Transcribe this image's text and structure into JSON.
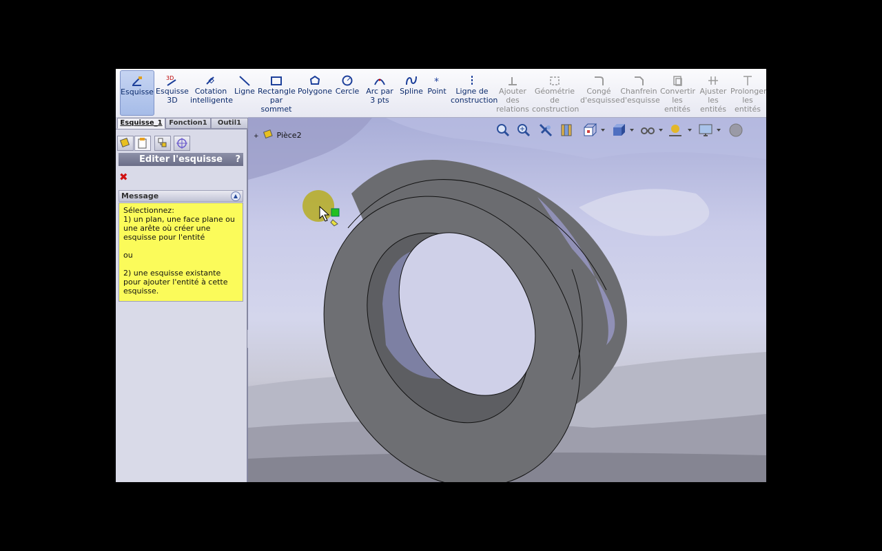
{
  "ribbon": {
    "tools": [
      {
        "id": "esquisse",
        "label": "Esquisse",
        "icon": "sketch-icon",
        "active": true,
        "enabled": true
      },
      {
        "id": "esquisse3d",
        "label": "Esquisse 3D",
        "icon": "sketch-3d-icon",
        "enabled": true
      },
      {
        "id": "cotation",
        "label": "Cotation intelligente",
        "icon": "smart-dimension-icon",
        "enabled": true
      },
      {
        "id": "ligne",
        "label": "Ligne",
        "icon": "line-icon",
        "enabled": true
      },
      {
        "id": "rectangle",
        "label": "Rectangle par sommet",
        "icon": "rectangle-icon",
        "enabled": true
      },
      {
        "id": "polygone",
        "label": "Polygone",
        "icon": "polygon-icon",
        "enabled": true
      },
      {
        "id": "cercle",
        "label": "Cercle",
        "icon": "circle-icon",
        "enabled": true
      },
      {
        "id": "arc",
        "label": "Arc par 3 pts",
        "icon": "arc-icon",
        "enabled": true
      },
      {
        "id": "spline",
        "label": "Spline",
        "icon": "spline-icon",
        "enabled": true
      },
      {
        "id": "point",
        "label": "Point",
        "icon": "point-icon",
        "enabled": true
      },
      {
        "id": "construction",
        "label": "Ligne de construction",
        "icon": "construction-line-icon",
        "enabled": true
      },
      {
        "id": "relations",
        "label": "Ajouter des relations",
        "icon": "add-relation-icon",
        "enabled": false
      },
      {
        "id": "geometrie",
        "label": "Géométrie de construction",
        "icon": "construction-geometry-icon",
        "enabled": false
      },
      {
        "id": "conge",
        "label": "Congé d'esquisse",
        "icon": "sketch-fillet-icon",
        "enabled": false
      },
      {
        "id": "chanfrein",
        "label": "Chanfrein d'esquisse",
        "icon": "sketch-chamfer-icon",
        "enabled": false
      },
      {
        "id": "convertir",
        "label": "Convertir les entités",
        "icon": "convert-entities-icon",
        "enabled": false
      },
      {
        "id": "ajuster",
        "label": "Ajuster les entités",
        "icon": "trim-entities-icon",
        "enabled": false
      },
      {
        "id": "prolonger",
        "label": "Prolonger les entités",
        "icon": "extend-entities-icon",
        "enabled": false
      }
    ]
  },
  "tabs": [
    {
      "label": "Esquisse_1",
      "active": true
    },
    {
      "label": "Fonction1",
      "active": false
    },
    {
      "label": "Outil1",
      "active": false
    }
  ],
  "property_manager": {
    "title": "Editer l'esquisse",
    "help": "?",
    "close": "✖",
    "message_header": "Message",
    "message_lines": [
      "Sélectionnez:",
      "1) un plan, une face plane ou une arête où créer une esquisse pour l'entité",
      "",
      "ou",
      "",
      "2) une esquisse existante pour ajouter l'entité à cette esquisse."
    ]
  },
  "tree": {
    "expand": "+",
    "part_name": "Pièce2"
  },
  "view_tools": [
    "zoom-fit-icon",
    "zoom-area-icon",
    "previous-view-icon",
    "section-view-icon",
    "view-orientation-icon",
    "display-style-icon",
    "hide-show-icon",
    "edit-appearance-icon",
    "apply-scene-icon",
    "view-settings-icon"
  ],
  "colors": {
    "accent": "#0b2a6b",
    "message_bg": "#fbfb5a",
    "part_gray": "#6e6f73"
  }
}
